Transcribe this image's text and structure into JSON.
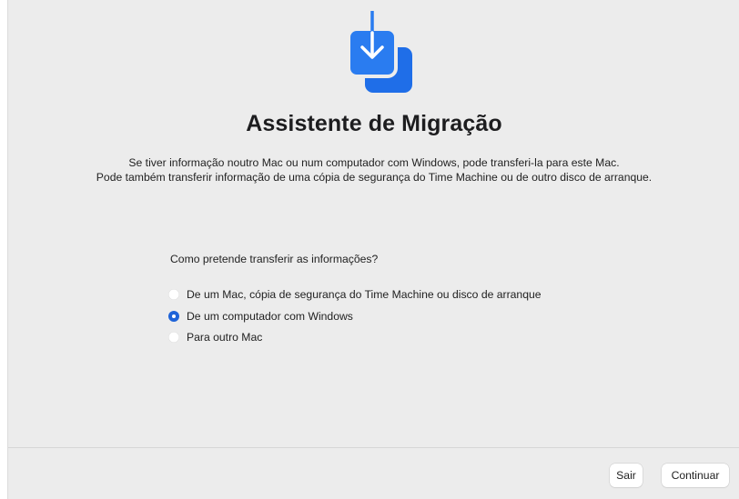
{
  "app": {
    "title": "Assistente de Migração",
    "icon": "migration-assistant-download-icon",
    "accent_color": "#1e63d8"
  },
  "description": {
    "line1": "Se tiver informação noutro Mac ou num computador com Windows, pode transferi-la para este Mac.",
    "line2": "Pode também transferir informação de uma cópia de segurança do Time Machine ou de outro disco de arranque."
  },
  "question": "Como pretende transferir as informações?",
  "options": [
    {
      "label": "De um Mac, cópia de segurança do Time Machine ou disco de arranque",
      "selected": false
    },
    {
      "label": "De um computador com Windows",
      "selected": true
    },
    {
      "label": "Para outro Mac",
      "selected": false
    }
  ],
  "buttons": {
    "quit": "Sair",
    "continue": "Continuar"
  }
}
